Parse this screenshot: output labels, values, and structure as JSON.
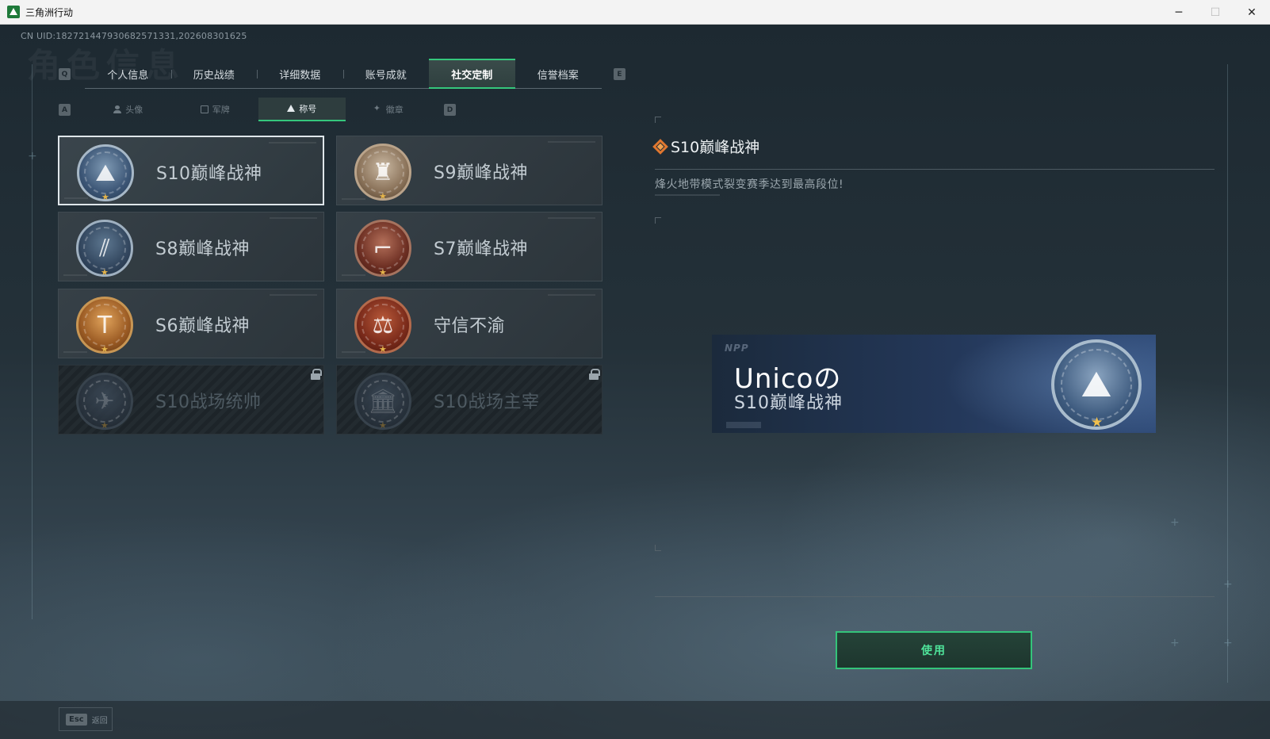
{
  "window": {
    "title": "三角洲行动",
    "minimize": "─",
    "maximize": "☐",
    "close": "✕"
  },
  "header": {
    "uid": "CN UID:1827214479306825713​31,202608301625",
    "bg_heading": "角色信息"
  },
  "keys": {
    "prev_main": "Q",
    "next_main": "E",
    "prev_sub": "A",
    "next_sub": "D"
  },
  "main_tabs": [
    {
      "label": "个人信息",
      "active": false
    },
    {
      "label": "历史战绩",
      "active": false
    },
    {
      "label": "详细数据",
      "active": false
    },
    {
      "label": "账号成就",
      "active": false
    },
    {
      "label": "社交定制",
      "active": true
    },
    {
      "label": "信誉档案",
      "active": false
    }
  ],
  "sub_tabs": [
    {
      "label": "头像",
      "icon": "avatar-icon",
      "active": false
    },
    {
      "label": "军牌",
      "icon": "dogtag-icon",
      "active": false
    },
    {
      "label": "称号",
      "icon": "title-icon",
      "active": true
    },
    {
      "label": "徽章",
      "icon": "badge-icon",
      "active": false
    }
  ],
  "titles": [
    {
      "label": "S10巅峰战神",
      "emblem": "tower-emblem",
      "locked": false,
      "selected": true
    },
    {
      "label": "S9巅峰战神",
      "emblem": "fortress-emblem",
      "locked": false,
      "selected": false
    },
    {
      "label": "S8巅峰战神",
      "emblem": "stripes-emblem",
      "locked": false,
      "selected": false
    },
    {
      "label": "S7巅峰战神",
      "emblem": "rifle-emblem",
      "locked": false,
      "selected": false
    },
    {
      "label": "S6巅峰战神",
      "emblem": "t-shield-emblem",
      "locked": false,
      "selected": false
    },
    {
      "label": "守信不渝",
      "emblem": "scales-emblem",
      "locked": false,
      "selected": false
    },
    {
      "label": "S10战场统帅",
      "emblem": "aircraft-emblem",
      "locked": true,
      "selected": false
    },
    {
      "label": "S10战场主宰",
      "emblem": "colosseum-emblem",
      "locked": true,
      "selected": false
    }
  ],
  "detail": {
    "title": "S10巅峰战神",
    "description": "烽火地带模式裂变赛季达到最高段位!",
    "preview": {
      "logo": "NPP",
      "player_name": "Unicoの",
      "title": "S10巅峰战神"
    },
    "use_button": "使用"
  },
  "footer": {
    "esc_key": "Esc",
    "esc_label": "返回"
  },
  "colors": {
    "accent_green": "#35c77c",
    "detail_icon_orange": "#e0772f",
    "star_gold": "#e4b44a"
  }
}
